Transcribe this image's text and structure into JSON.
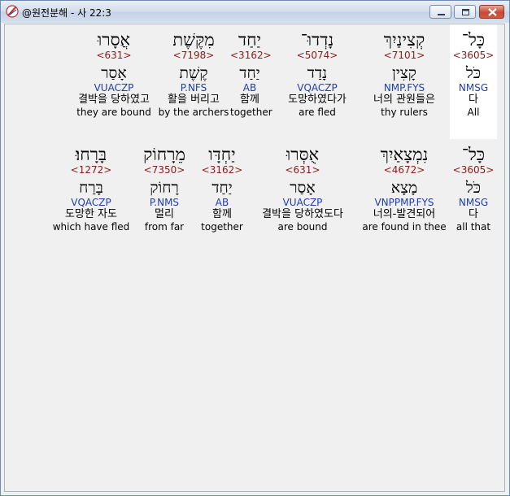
{
  "window": {
    "title": "@원전분해 - 사 22:3",
    "icon": "app-icon",
    "controls": [
      "minimize-icon",
      "maximize-icon",
      "close-icon"
    ]
  },
  "rows": [
    {
      "words": [
        {
          "hebrew": "אֲסָרוּ",
          "strong": "<631>",
          "lemma": "אָסַר",
          "parsing": "VUACZP",
          "korean": "결박을 당하였고",
          "english": "they are bound"
        },
        {
          "hebrew": "מִקֶּשֶׁת",
          "strong": "<7198>",
          "lemma": "קֶשֶׁת",
          "parsing": "P.NFS",
          "korean": "활을 버리고",
          "english": "by the archers"
        },
        {
          "hebrew": "יַחַד",
          "strong": "<3162>",
          "lemma": "יַחַד",
          "parsing": "AB",
          "korean": "함께",
          "english": "together"
        },
        {
          "hebrew": "נָדְדוּ־",
          "strong": "<5074>",
          "lemma": "נָדַד",
          "parsing": "VQACZP",
          "korean": "도망하였다가",
          "english": "are fled"
        },
        {
          "hebrew": "קְצִינַיִךְ",
          "strong": "<7101>",
          "lemma": "קָצִין",
          "parsing": "NMP.FYS",
          "korean": "너의 관원들은",
          "english": "thy rulers"
        },
        {
          "hebrew": "כָּל־",
          "strong": "<3605>",
          "lemma": "כֹּל",
          "parsing": "NMSG",
          "korean": "다",
          "english": "All"
        }
      ]
    },
    {
      "words": [
        {
          "hebrew": "בָּרָחוּ׃",
          "strong": "<1272>",
          "lemma": "בָּרַח",
          "parsing": "VQACZP",
          "korean": "도망한 자도",
          "english": "which have fled"
        },
        {
          "hebrew": "מֵרָחוֹק",
          "strong": "<7350>",
          "lemma": "רָחוֹק",
          "parsing": "P.NMS",
          "korean": "멀리",
          "english": "from far"
        },
        {
          "hebrew": "יַחְדָּו",
          "strong": "<3162>",
          "lemma": "יַחַד",
          "parsing": "AB",
          "korean": "함께",
          "english": "together"
        },
        {
          "hebrew": "אֻסְּרוּ",
          "strong": "<631>",
          "lemma": "אָסַר",
          "parsing": "VUACZP",
          "korean": "결박을 당하였도다",
          "english": "are bound"
        },
        {
          "hebrew": "נִמְצָאַיִךְ",
          "strong": "<4672>",
          "lemma": "מָצָא",
          "parsing": "VNPPMP.FYS",
          "korean": "너의-발견되어",
          "english": "are found in thee"
        },
        {
          "hebrew": "כָּל־",
          "strong": "<3605>",
          "lemma": "כֹּל",
          "parsing": "NMSG",
          "korean": "다",
          "english": "all that"
        }
      ]
    }
  ]
}
